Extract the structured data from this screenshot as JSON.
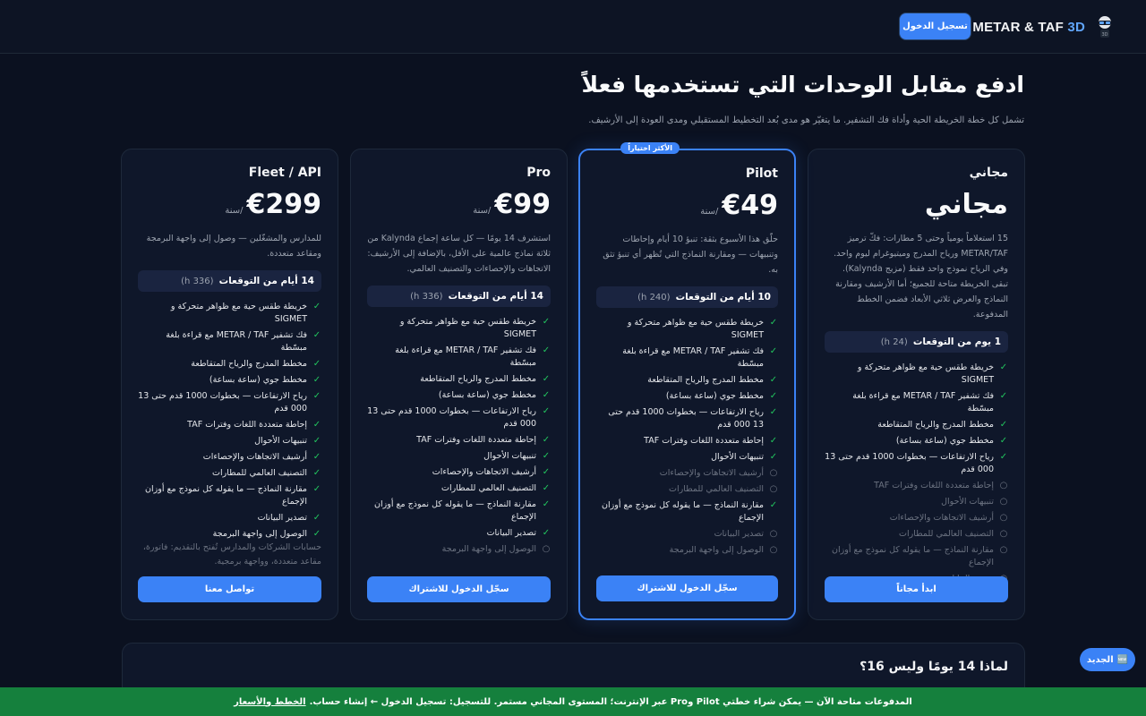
{
  "header": {
    "brand_main": "METAR & TAF",
    "brand_accent": "3D",
    "login_label": "تسجيل الدخول"
  },
  "hero": {
    "title": "ادفع مقابل الوحدات التي تستخدمها فعلاً",
    "subtitle": "تشمل كل خطة الخريطة الحية وأداة فك التشفير. ما يتغيّر هو مدى بُعد التخطيط المستقبلي ومدى العودة إلى الأرشيف."
  },
  "plans": [
    {
      "name": "مجاني",
      "price": "مجاني",
      "per": "",
      "desc": "15 استعلاماً يومياً وحتى 5 مطارات: فكّ ترميز METAR/TAF ورياح المدرج وميتيوغرام ليوم واحد. وفي الرياح نموذج واحد فقط (مزيج Kalynda). تبقى الخريطة متاحة للجميع؛ أما الأرشيف ومقارنة النماذج والعرض ثلاثي الأبعاد فضمن الخطط المدفوعة.",
      "forecast_days": "1 يوم من التوقعات",
      "forecast_hours": "(24 h)",
      "features": [
        {
          "label": "خريطة طقس حية مع ظواهر متحركة و SIGMET",
          "on": true
        },
        {
          "label": "فك تشفير METAR / TAF مع قراءة بلغة مبسّطة",
          "on": true
        },
        {
          "label": "مخطط المدرج والرياح المتقاطعة",
          "on": true
        },
        {
          "label": "مخطط جوي (ساعة بساعة)",
          "on": true
        },
        {
          "label": "رياح الارتفاعات — بخطوات 1000 قدم حتى 13 000 قدم",
          "on": true
        },
        {
          "label": "إحاطة متعددة اللغات وفترات TAF",
          "on": false
        },
        {
          "label": "تنبيهات الأحوال",
          "on": false
        },
        {
          "label": "أرشيف الاتجاهات والإحصاءات",
          "on": false
        },
        {
          "label": "التصنيف العالمي للمطارات",
          "on": false
        },
        {
          "label": "مقارنة النماذج — ما يقوله كل نموذج مع أوزان الإجماع",
          "on": false
        },
        {
          "label": "تصدير البيانات",
          "on": false
        },
        {
          "label": "الوصول إلى واجهة البرمجة",
          "on": false
        }
      ],
      "cta": "ابدأ مجاناً"
    },
    {
      "name": "Pilot",
      "price": "€49",
      "per": "/سنة",
      "badge": "الأكثر اختياراً",
      "desc": "حلّق هذا الأسبوع بثقة: تنبؤ 10 أيام وإحاطات وتنبيهات — ومقارنة النماذج التي تُظهر أي تنبؤ تثق به.",
      "forecast_days": "10 أيام من التوقعات",
      "forecast_hours": "(240 h)",
      "features": [
        {
          "label": "خريطة طقس حية مع ظواهر متحركة و SIGMET",
          "on": true
        },
        {
          "label": "فك تشفير METAR / TAF مع قراءة بلغة مبسّطة",
          "on": true
        },
        {
          "label": "مخطط المدرج والرياح المتقاطعة",
          "on": true
        },
        {
          "label": "مخطط جوي (ساعة بساعة)",
          "on": true
        },
        {
          "label": "رياح الارتفاعات — بخطوات 1000 قدم حتى 13 000 قدم",
          "on": true
        },
        {
          "label": "إحاطة متعددة اللغات وفترات TAF",
          "on": true
        },
        {
          "label": "تنبيهات الأحوال",
          "on": true
        },
        {
          "label": "أرشيف الاتجاهات والإحصاءات",
          "on": false
        },
        {
          "label": "التصنيف العالمي للمطارات",
          "on": false
        },
        {
          "label": "مقارنة النماذج — ما يقوله كل نموذج مع أوزان الإجماع",
          "on": true
        },
        {
          "label": "تصدير البيانات",
          "on": false
        },
        {
          "label": "الوصول إلى واجهة البرمجة",
          "on": false
        }
      ],
      "cta": "سجّل الدخول للاشتراك"
    },
    {
      "name": "Pro",
      "price": "€99",
      "per": "/سنة",
      "desc": "استشرف 14 يومًا — كل ساعة إجماع Kalynda من ثلاثة نماذج عالمية على الأقل، بالإضافة إلى الأرشيف: الاتجاهات والإحصاءات والتصنيف العالمي.",
      "forecast_days": "14 أيام من التوقعات",
      "forecast_hours": "(336 h)",
      "features": [
        {
          "label": "خريطة طقس حية مع ظواهر متحركة و SIGMET",
          "on": true
        },
        {
          "label": "فك تشفير METAR / TAF مع قراءة بلغة مبسّطة",
          "on": true
        },
        {
          "label": "مخطط المدرج والرياح المتقاطعة",
          "on": true
        },
        {
          "label": "مخطط جوي (ساعة بساعة)",
          "on": true
        },
        {
          "label": "رياح الارتفاعات — بخطوات 1000 قدم حتى 13 000 قدم",
          "on": true
        },
        {
          "label": "إحاطة متعددة اللغات وفترات TAF",
          "on": true
        },
        {
          "label": "تنبيهات الأحوال",
          "on": true
        },
        {
          "label": "أرشيف الاتجاهات والإحصاءات",
          "on": true
        },
        {
          "label": "التصنيف العالمي للمطارات",
          "on": true
        },
        {
          "label": "مقارنة النماذج — ما يقوله كل نموذج مع أوزان الإجماع",
          "on": true
        },
        {
          "label": "تصدير البيانات",
          "on": true
        },
        {
          "label": "الوصول إلى واجهة البرمجة",
          "on": false
        }
      ],
      "cta": "سجّل الدخول للاشتراك"
    },
    {
      "name": "Fleet / API",
      "price": "€299",
      "per": "/سنة",
      "desc": "للمدارس والمشغّلين — وصول إلى واجهة البرمجة ومقاعد متعددة.",
      "forecast_days": "14 أيام من التوقعات",
      "forecast_hours": "(336 h)",
      "features": [
        {
          "label": "خريطة طقس حية مع ظواهر متحركة و SIGMET",
          "on": true
        },
        {
          "label": "فك تشفير METAR / TAF مع قراءة بلغة مبسّطة",
          "on": true
        },
        {
          "label": "مخطط المدرج والرياح المتقاطعة",
          "on": true
        },
        {
          "label": "مخطط جوي (ساعة بساعة)",
          "on": true
        },
        {
          "label": "رياح الارتفاعات — بخطوات 1000 قدم حتى 13 000 قدم",
          "on": true
        },
        {
          "label": "إحاطة متعددة اللغات وفترات TAF",
          "on": true
        },
        {
          "label": "تنبيهات الأحوال",
          "on": true
        },
        {
          "label": "أرشيف الاتجاهات والإحصاءات",
          "on": true
        },
        {
          "label": "التصنيف العالمي للمطارات",
          "on": true
        },
        {
          "label": "مقارنة النماذج — ما يقوله كل نموذج مع أوزان الإجماع",
          "on": true
        },
        {
          "label": "تصدير البيانات",
          "on": true
        },
        {
          "label": "الوصول إلى واجهة البرمجة",
          "on": true
        }
      ],
      "note": "حسابات الشركات والمدارس تُفتح بالتقديم: فاتورة، مقاعد متعددة، وواجهة برمجية.",
      "cta": "تواصل معنا"
    }
  ],
  "faq": {
    "title": "لماذا 14 يومًا وليس 16؟"
  },
  "news_button": "الجديد",
  "banner": {
    "text": "المدفوعات متاحة الآن — يمكن شراء خطتي Pilot وPro عبر الإنترنت؛ المستوى المجاني مستمر. للتسجيل: تسجيل الدخول ← إنشاء حساب.",
    "link": "الخطط والأسعار"
  },
  "colors": {
    "accent": "#3b82f6",
    "check": "#22c55e",
    "banner": "#15803d"
  }
}
